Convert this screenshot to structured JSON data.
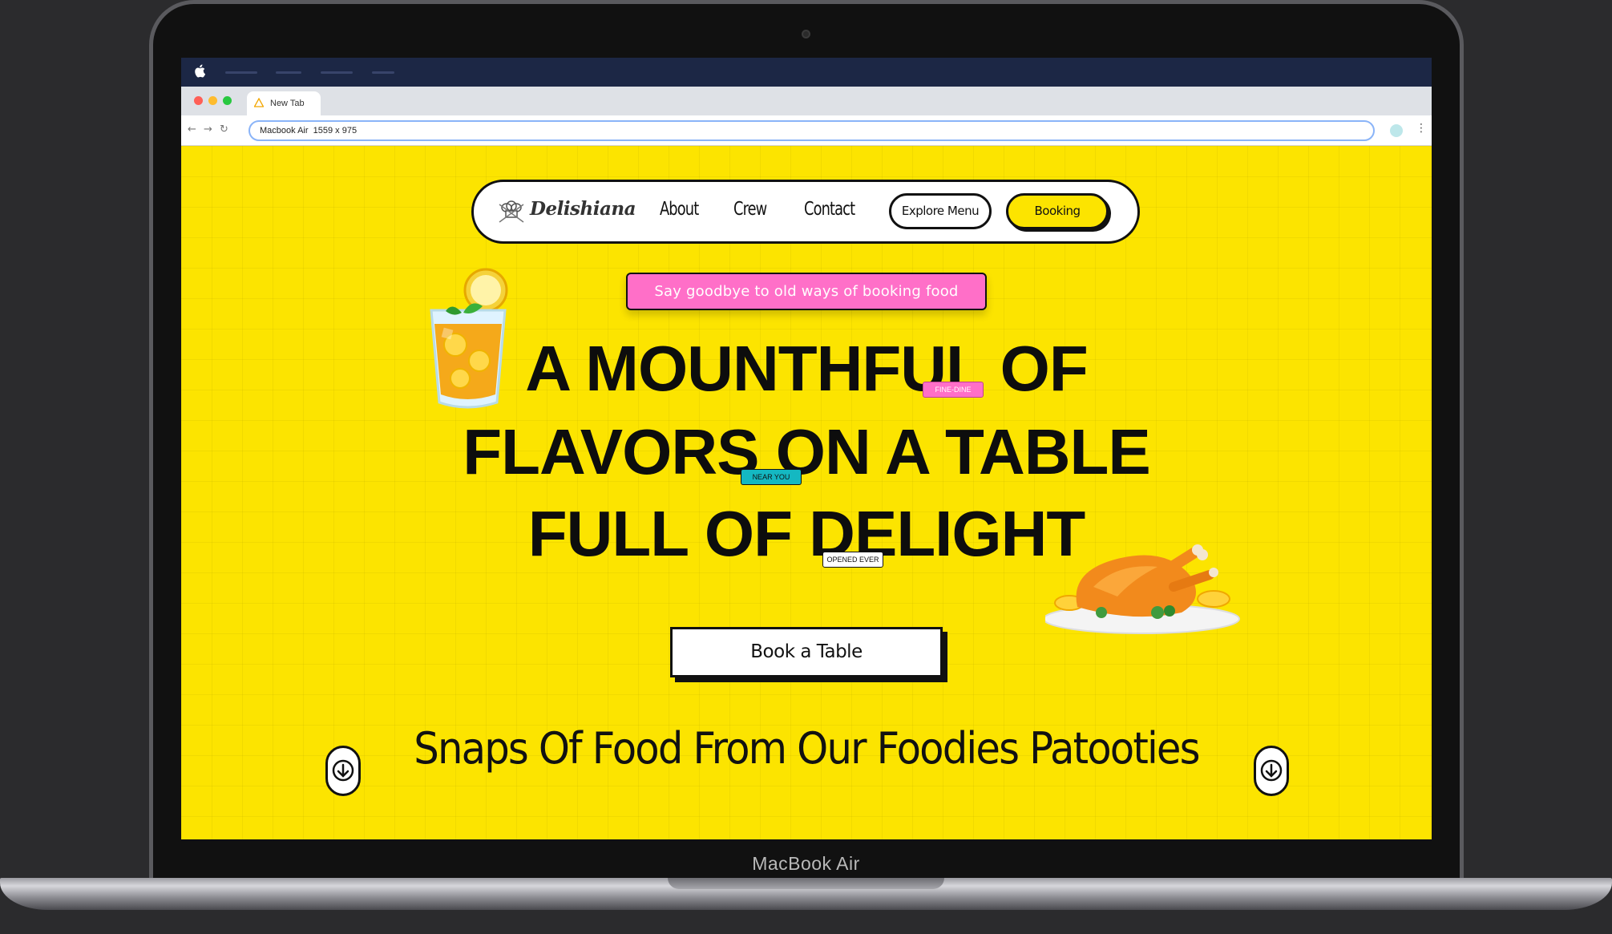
{
  "device": {
    "bezel_label": "MacBook Air"
  },
  "browser": {
    "tab_title": "New Tab",
    "address_text": "Macbook Air  1559 x 975"
  },
  "site": {
    "logo_text": "Delishiana",
    "nav": {
      "about": "About",
      "crew": "Crew",
      "contact": "Contact"
    },
    "explore_label": "Explore Menu",
    "booking_label": "Booking",
    "promo_text": "Say goodbye to old ways of booking food",
    "headline": {
      "line1": "A MOUNTHFUL OF",
      "line2": "FLAVORS ON A TABLE",
      "line3": "FULL OF DELIGHT"
    },
    "tags": {
      "pink": "FINE-DINE",
      "teal": "NEAR YOU",
      "white": "OPENED EVER"
    },
    "cta_label": "Book a Table",
    "snaps_heading": "Snaps Of Food From Our Foodies Patooties"
  },
  "colors": {
    "page_background": "#fce400",
    "promo_pink": "#ff6fc8",
    "tag_teal": "#14b8c2",
    "menubar": "#1c2745"
  },
  "icons": {
    "apple": "apple-icon",
    "logo": "chef-logo-icon",
    "scroll_left": "arrow-down-icon",
    "scroll_right": "arrow-down-icon"
  }
}
